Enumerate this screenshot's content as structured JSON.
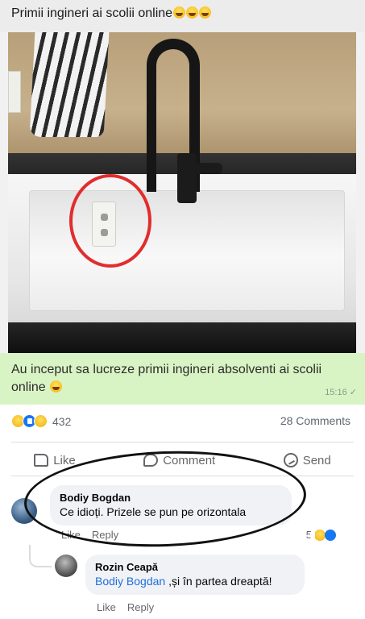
{
  "post": {
    "caption": "Primii ingineri  ai scolii online",
    "caption_emojis": [
      "laughing-emoji",
      "laughing-emoji",
      "laughing-emoji"
    ]
  },
  "photo": {
    "description_elements": [
      "towel",
      "faucet",
      "sink",
      "wall-outlet",
      "red-circle"
    ]
  },
  "green_message": {
    "text": "Au inceput sa lucreze primii ingineri absolventi ai scolii online",
    "time": "15:16 ✓"
  },
  "fb": {
    "reactions_count": "432",
    "comments_count": "28 Comments",
    "actions": {
      "like": "Like",
      "comment": "Comment",
      "send": "Send"
    },
    "comments": [
      {
        "author": "Bodiy Bogdan",
        "text": "Ce idioți. Prizele se pun pe orizontala",
        "like": "Like",
        "reply": "Reply",
        "reaction_count": "5"
      }
    ],
    "reply": {
      "author": "Rozin Ceapă",
      "mention": "Bodiy Bogdan",
      "text": " ,și în partea dreaptă!",
      "like": "Like",
      "reply": "Reply"
    }
  },
  "colors": {
    "green_bubble": "#d9f4c4",
    "fb_blue": "#1877f2",
    "annotation_red": "#e12d2d",
    "mention_blue": "#216fdb"
  }
}
